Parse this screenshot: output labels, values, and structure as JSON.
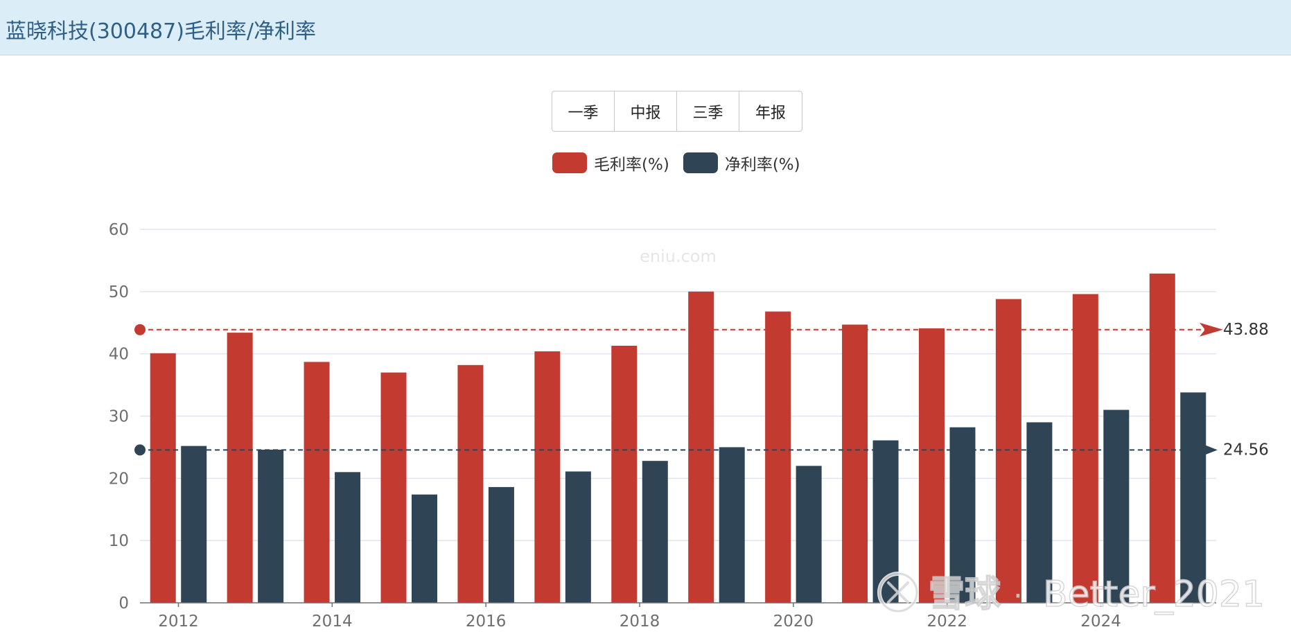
{
  "header": {
    "title": "蓝晓科技(300487)毛利率/净利率"
  },
  "period_buttons": [
    "一季",
    "中报",
    "三季",
    "年报"
  ],
  "watermark": "eniu.com",
  "source_watermark": {
    "logo_text": "雪球",
    "user": "Better_2021"
  },
  "colors": {
    "gross": "#c23a30",
    "net": "#2f4454",
    "grid": "#e0e3f0",
    "axis": "#6e6e6e",
    "header_bg": "#dbeef7"
  },
  "chart_data": {
    "type": "bar",
    "categories": [
      "2012",
      "2013",
      "2014",
      "2015",
      "2016",
      "2017",
      "2018",
      "2019",
      "2020",
      "2021",
      "2022",
      "2023",
      "2024",
      "2025"
    ],
    "x_tick_labels": [
      "2012",
      "2014",
      "2016",
      "2018",
      "2020",
      "2022",
      "2024"
    ],
    "series": [
      {
        "name": "毛利率(%)",
        "values": [
          40.1,
          43.4,
          38.7,
          37.0,
          38.2,
          40.4,
          41.3,
          50.0,
          46.8,
          44.7,
          44.1,
          48.8,
          49.6,
          52.9
        ]
      },
      {
        "name": "净利率(%)",
        "values": [
          25.2,
          24.6,
          21.0,
          17.4,
          18.6,
          21.1,
          22.8,
          25.0,
          22.0,
          26.1,
          28.2,
          29.0,
          31.0,
          33.8
        ]
      }
    ],
    "ylim": [
      0,
      60
    ],
    "y_ticks": [
      0,
      10,
      20,
      30,
      40,
      50,
      60
    ],
    "mark_lines": [
      {
        "series": "毛利率(%)",
        "value": 43.88,
        "label": "43.88"
      },
      {
        "series": "净利率(%)",
        "value": 24.56,
        "label": "24.56"
      }
    ],
    "grid": true,
    "legend_position": "top-center"
  }
}
